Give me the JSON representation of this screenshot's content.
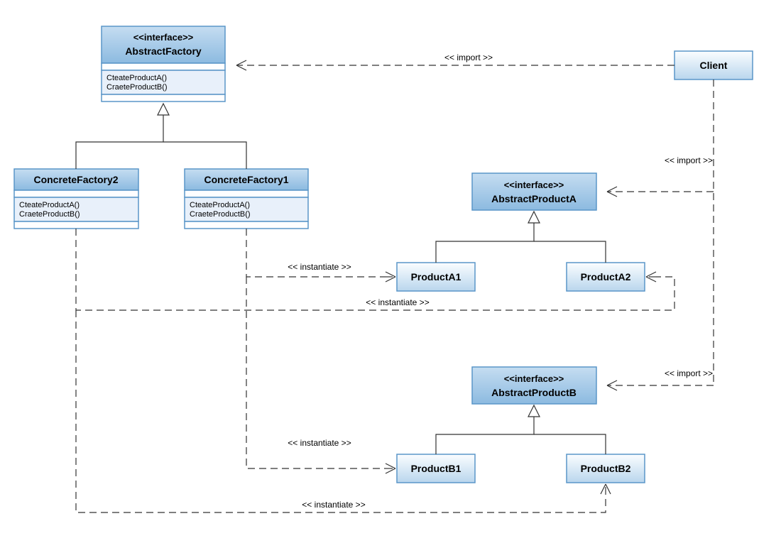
{
  "boxes": {
    "abstractFactory": {
      "stereo": "<<interface>>",
      "title": "AbstractFactory",
      "methods": [
        "CteateProductA()",
        "CraeteProductB()"
      ]
    },
    "concreteFactory2": {
      "title": "ConcreteFactory2",
      "methods": [
        "CteateProductA()",
        "CraeteProductB()"
      ]
    },
    "concreteFactory1": {
      "title": "ConcreteFactory1",
      "methods": [
        "CteateProductA()",
        "CraeteProductB()"
      ]
    },
    "client": {
      "title": "Client"
    },
    "abstractProductA": {
      "stereo": "<<interface>>",
      "title": "AbstractProductA"
    },
    "abstractProductB": {
      "stereo": "<<interface>>",
      "title": "AbstractProductB"
    },
    "productA1": {
      "title": "ProductA1"
    },
    "productA2": {
      "title": "ProductA2"
    },
    "productB1": {
      "title": "ProductB1"
    },
    "productB2": {
      "title": "ProductB2"
    }
  },
  "labels": {
    "import": "<< import >>",
    "instantiate": "<< instantiate >>"
  }
}
